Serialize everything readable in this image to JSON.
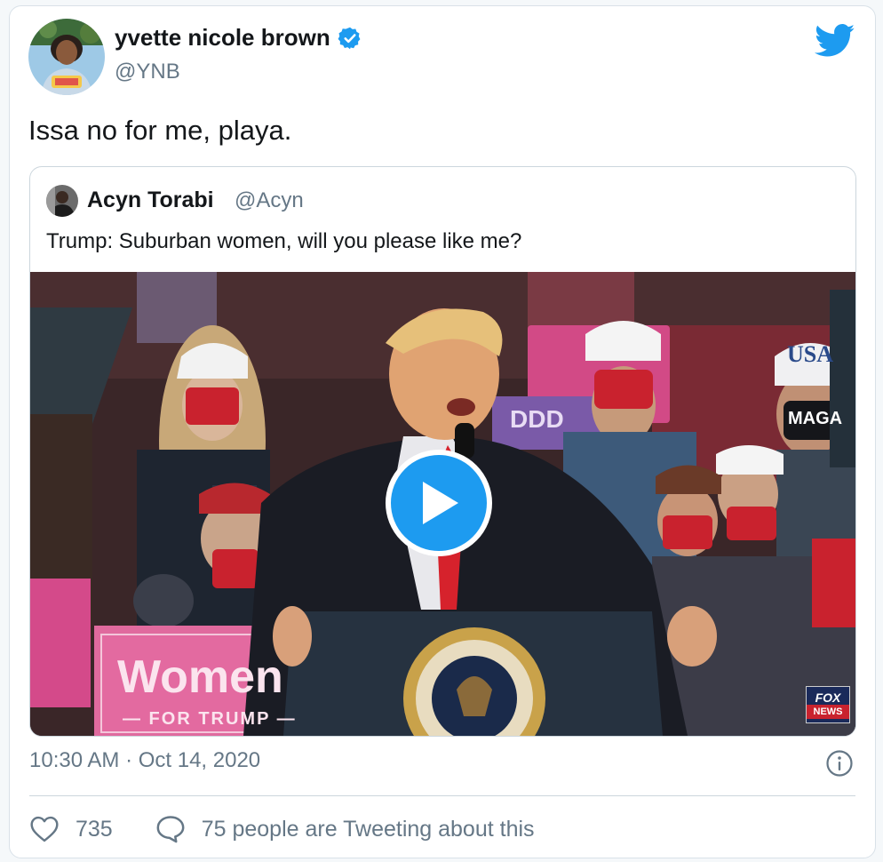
{
  "author": {
    "name": "yvette nicole brown",
    "handle": "@YNB",
    "verified_icon": "verified-badge-icon"
  },
  "brand_icon": "twitter-bird-icon",
  "tweet_text": "Issa no for me, playa.",
  "quoted_tweet": {
    "name": "Acyn Torabi",
    "handle": "@Acyn",
    "text": "Trump: Suburban women, will you please like me?",
    "media": {
      "type": "video",
      "play_icon": "play-icon",
      "visible_text": {
        "sign_main": "Women",
        "sign_sub": "— FOR TRUMP —",
        "hat_usa": "USA",
        "mask_maga": "MAGA",
        "sign_ddd": "DDD",
        "watermark_fox": "FOX",
        "watermark_news": "NEWS"
      }
    }
  },
  "timestamp": "10:30 AM · Oct 14, 2020",
  "info_icon": "info-icon",
  "actions": {
    "likes": "735",
    "conversation": "75 people are Tweeting about this"
  },
  "colors": {
    "accent": "#1d9bf0",
    "text": "#14171a",
    "secondary": "#657786",
    "border": "#ccd6dd",
    "sign_pink": "#d9457a"
  }
}
